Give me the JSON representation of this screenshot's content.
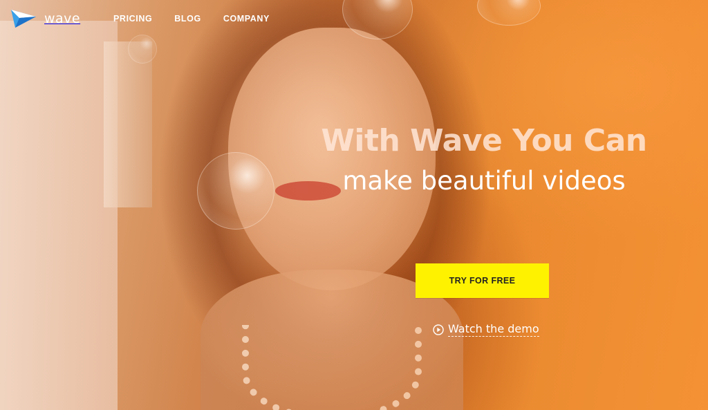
{
  "brand": {
    "name": "wave",
    "logo_icon": "wave-play-logo"
  },
  "nav": {
    "items": [
      {
        "label": "PRICING"
      },
      {
        "label": "BLOG"
      },
      {
        "label": "COMPANY"
      }
    ]
  },
  "hero": {
    "title": "With Wave You Can",
    "subtitle": "make beautiful videos",
    "cta_label": "TRY FOR FREE",
    "demo_label": "Watch the demo",
    "demo_icon": "play-circle-icon",
    "background": "photo of a woman with soap bubbles under warm orange light"
  },
  "colors": {
    "cta": "#fff200",
    "overlay": "#e8862f"
  }
}
